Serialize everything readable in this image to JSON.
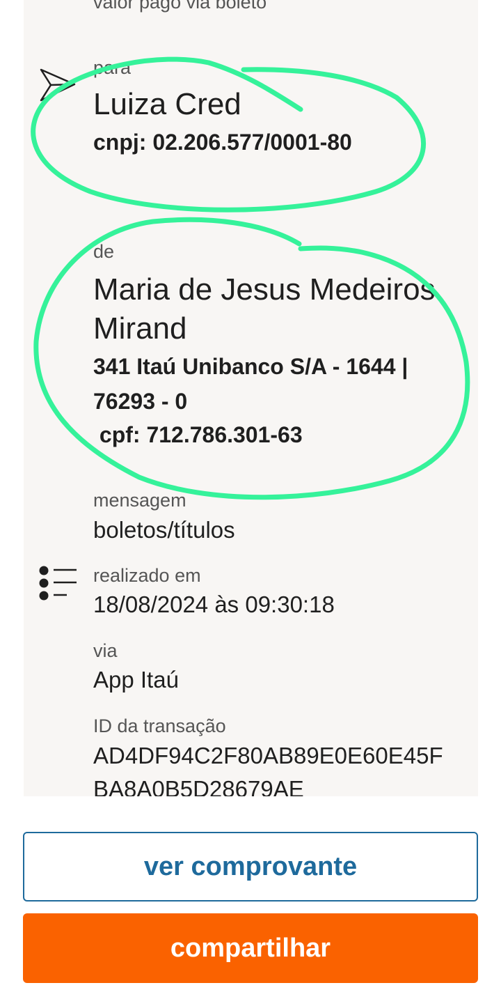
{
  "top_partial": "valor pago via boleto",
  "recipient": {
    "label": "para",
    "name": "Luiza Cred",
    "doc": "cnpj: 02.206.577/0001-80"
  },
  "payer": {
    "label": "de",
    "name_line1": "Maria de Jesus Medeiros",
    "name_line2": "Mirand",
    "bank_line1": "341 Itaú Unibanco S/A - 1644 |",
    "bank_line2": "76293 - 0",
    "doc": " cpf: 712.786.301-63"
  },
  "message": {
    "label": "mensagem",
    "value": "boletos/títulos"
  },
  "datetime": {
    "label": "realizado em",
    "value": "18/08/2024 às 09:30:18"
  },
  "channel": {
    "label": "via",
    "value": "App Itaú"
  },
  "transaction": {
    "label": "ID da transação",
    "line1": "AD4DF94C2F80AB89E0E60E45F",
    "line2": "BA8A0B5D28679AE"
  },
  "buttons": {
    "view_receipt": "ver comprovante",
    "share": "compartilhar"
  },
  "colors": {
    "card_bg": "#f8f6f4",
    "accent_blue": "#1e6a9c",
    "accent_orange": "#fa6200",
    "annotation_green": "#35f29a"
  },
  "icons": {
    "send": "send-icon",
    "list": "list-icon"
  }
}
